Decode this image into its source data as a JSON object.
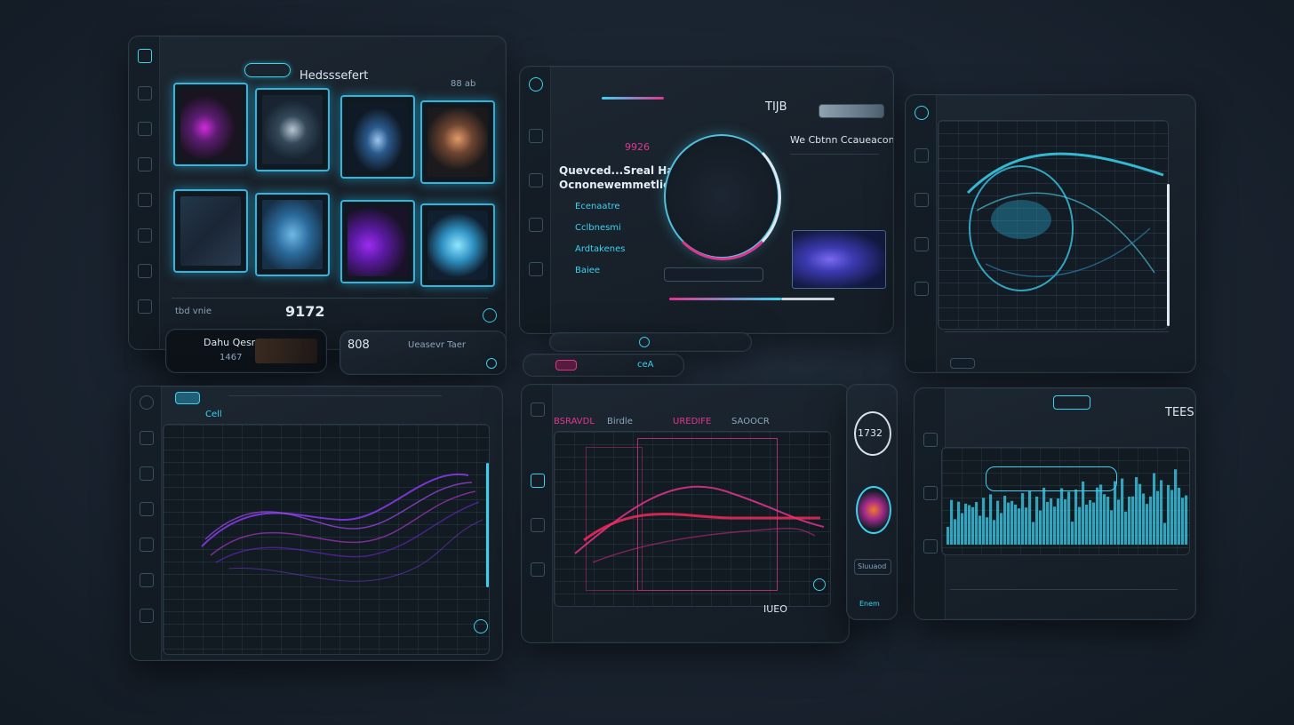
{
  "panel1": {
    "header_title": "Hedsssefert",
    "header_right": "88 ab",
    "footer_value": "9172",
    "footer_label": "tbd vnie",
    "card_value": "1467",
    "card_label": "Dahu Qesr",
    "card2_code": "808",
    "card2_label": "Ueasevr Taer",
    "thumbnails": [
      "magenta-ribbon",
      "wireframe-sphere",
      "blue-blob",
      "orange-lattice",
      "data-noise",
      "blue-particles",
      "purple-cloth",
      "cyan-sphere"
    ]
  },
  "panel2": {
    "header_value": "TIJB",
    "title_line1": "Quevced...Sreal Han",
    "title_line2": "Ocnonewemmetlied",
    "right_title": "We Cbtnn Ccaueacon",
    "left_items": [
      "Ecenaatre",
      "Cclbnesmi",
      "Ardtakenes",
      "Baiee"
    ],
    "readout": "9926",
    "footer_tab": "ceA"
  },
  "panel4": {
    "header_btn": "Cell"
  },
  "panel5": {
    "top_labels": [
      "BSRAVDL",
      "Birdle",
      "UREDIFE",
      "SAOOCR"
    ],
    "footer_value": "IUEO",
    "gauge_value": "1732",
    "gauge_label": "Sluuaod",
    "side_btn": "Enem"
  },
  "panel6": {
    "header_value": "TEES"
  },
  "colors": {
    "accent_cyan": "#3cd2f0",
    "accent_magenta": "#e0368f",
    "accent_purple": "#8a3cf0"
  }
}
